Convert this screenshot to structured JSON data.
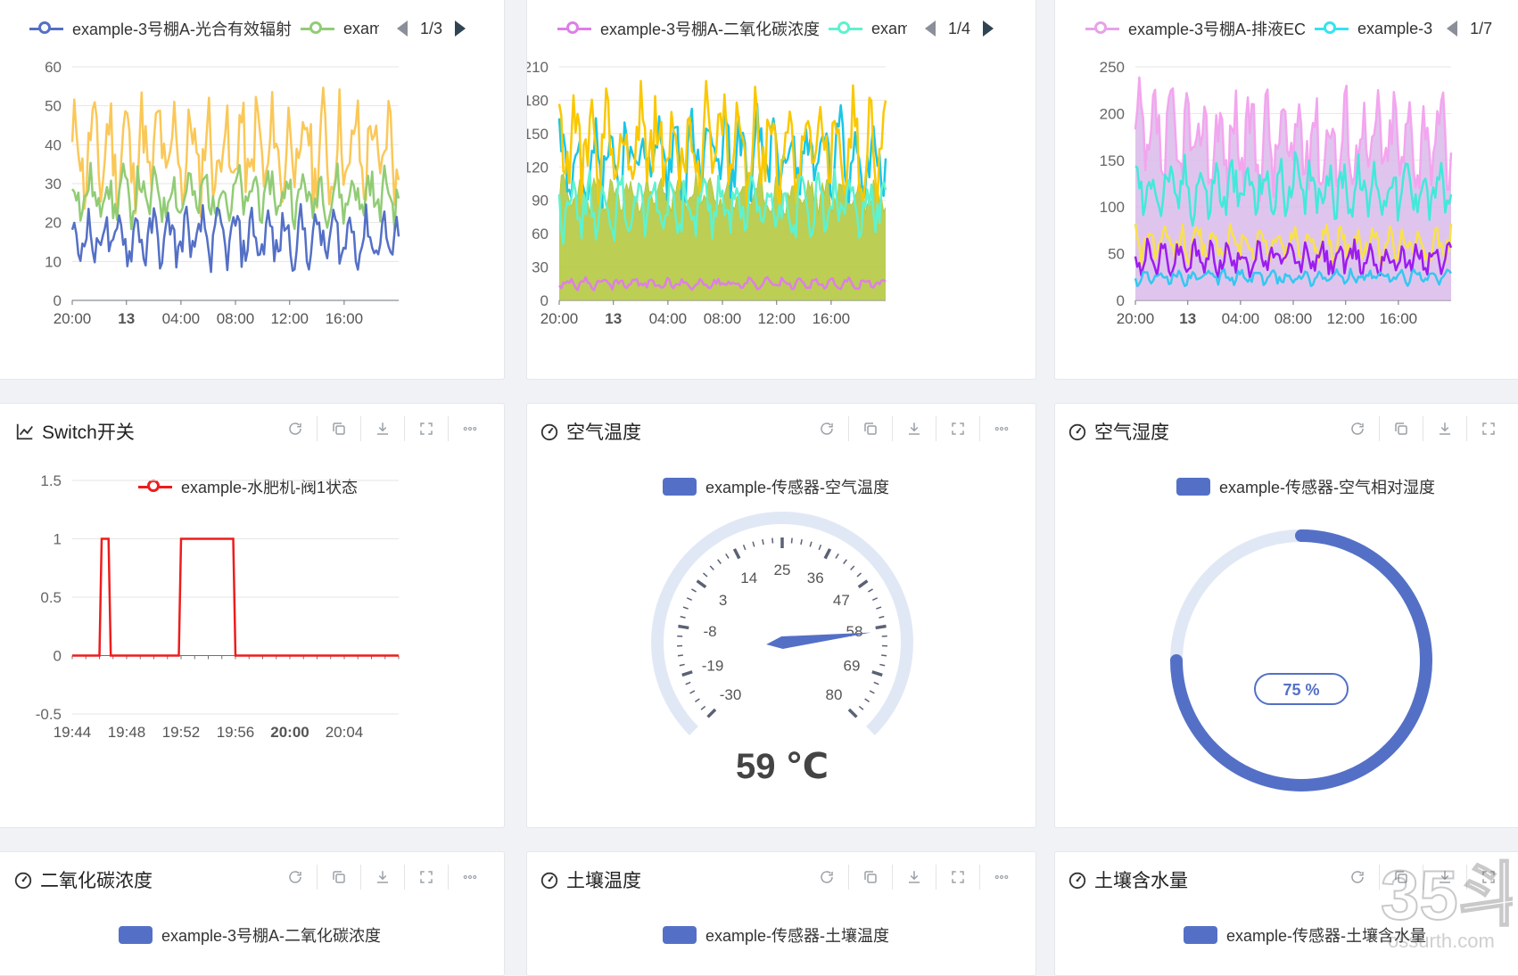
{
  "top_charts": [
    {
      "legend": [
        "example-3号棚A-光合有效辐射",
        "exam"
      ],
      "legend_colors": [
        "#5470c6",
        "#91cc75",
        "#fac858"
      ],
      "page": "1/3",
      "y_ticks": [
        "60",
        "50",
        "40",
        "30",
        "20",
        "10",
        "0"
      ],
      "x_ticks": [
        "20:00",
        "13",
        "04:00",
        "08:00",
        "12:00",
        "16:00"
      ]
    },
    {
      "legend": [
        "example-3号棚A-二氧化碳浓度",
        "exam"
      ],
      "legend_colors": [
        "#de7ee8",
        "#5ff2cf",
        "#fac800",
        "#19c7e6"
      ],
      "page": "1/4",
      "y_ticks": [
        "210",
        "180",
        "150",
        "120",
        "90",
        "60",
        "30",
        "0"
      ],
      "x_ticks": [
        "20:00",
        "13",
        "04:00",
        "08:00",
        "12:00",
        "16:00"
      ]
    },
    {
      "legend": [
        "example-3号棚A-排液EC",
        "example-3"
      ],
      "legend_colors": [
        "#f3a5ef",
        "#35e3f0",
        "#9d1cf0",
        "#f9e14b",
        "#42e9db"
      ],
      "page": "1/7",
      "y_ticks": [
        "250",
        "200",
        "150",
        "100",
        "50",
        "0"
      ],
      "x_ticks": [
        "20:00",
        "13",
        "04:00",
        "08:00",
        "12:00",
        "16:00"
      ]
    }
  ],
  "switch_card": {
    "title": "Switch开关",
    "legend": "example-水肥机-阀1状态",
    "line_color": "#ee1c1c",
    "y_ticks": [
      "1.5",
      "1",
      "0.5",
      "0",
      "-0.5"
    ],
    "x_ticks": [
      "19:44",
      "19:48",
      "19:52",
      "19:56",
      "20:00",
      "20:04"
    ],
    "chart_data": {
      "type": "line",
      "series": [
        {
          "name": "example-水肥机-阀1状态",
          "x": [
            "19:46:00",
            "19:46:10",
            "19:46:40",
            "19:46:50",
            "19:51:50",
            "19:52:00",
            "19:55:50",
            "19:56:00"
          ],
          "values": [
            0,
            1,
            1,
            0,
            0,
            1,
            1,
            0
          ]
        }
      ],
      "ylim": [
        -0.5,
        1.5
      ]
    }
  },
  "air_temp_card": {
    "title": "空气温度",
    "legend": "example-传感器-空气温度",
    "gauge_labels": [
      "-30",
      "-19",
      "-8",
      "3",
      "14",
      "25",
      "36",
      "47",
      "58",
      "69",
      "80"
    ],
    "value": 59,
    "value_text": "59 ℃"
  },
  "air_humidity_card": {
    "title": "空气湿度",
    "legend": "example-传感器-空气相对湿度",
    "value": 75,
    "value_text": "75 %"
  },
  "co2_card": {
    "title": "二氧化碳浓度",
    "legend": "example-3号棚A-二氧化碳浓度"
  },
  "soil_temp_card": {
    "title": "土壤温度",
    "legend": "example-传感器-土壤温度"
  },
  "soil_water_card": {
    "title": "土壤含水量",
    "legend": "example-传感器-土壤含水量"
  },
  "watermark": {
    "big": "35斗",
    "small": "ossurth.com"
  }
}
